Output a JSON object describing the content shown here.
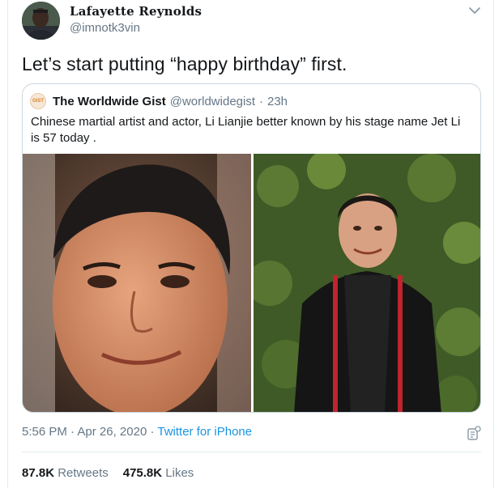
{
  "tweet": {
    "display_name": "Lafayette Reynolds",
    "handle": "@imnotk3vin",
    "text": "Let’s start putting “happy birthday” first.",
    "time": "5:56 PM",
    "date": "Apr 26, 2020",
    "source": "Twitter for iPhone",
    "separator": "·",
    "retweets_count": "87.8K",
    "retweets_label": "Retweets",
    "likes_count": "475.8K",
    "likes_label": "Likes"
  },
  "quoted_tweet": {
    "avatar_text": "GIST",
    "name": "The Worldwide Gist",
    "handle": "@worldwidegist",
    "separator": "·",
    "time": "23h",
    "text": "Chinese martial artist and actor, Li Lianjie better known by his stage name Jet Li is 57 today ."
  },
  "icons": {
    "caret": "chevron-down-icon",
    "analytics": "analytics-icon"
  },
  "colors": {
    "link": "#1b95e0",
    "secondary_text": "#657786",
    "border": "#ccd6dd"
  }
}
